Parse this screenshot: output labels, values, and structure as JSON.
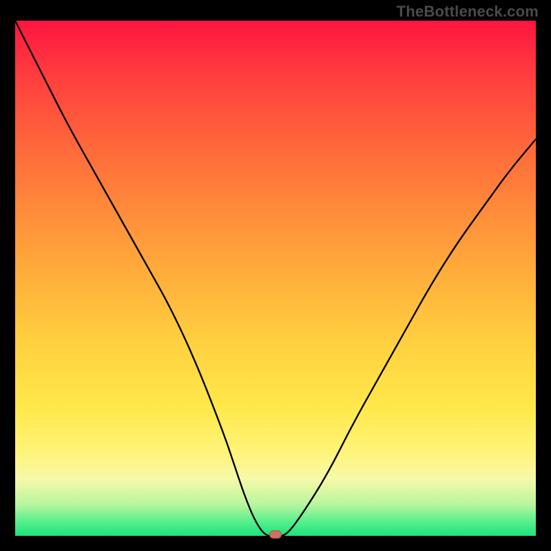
{
  "watermark": "TheBottleneck.com",
  "colors": {
    "frame": "#000000",
    "curve_stroke": "#000000",
    "marker_fill": "#d17060",
    "gradient_top": "#ff1540",
    "gradient_bottom": "#18e47a"
  },
  "chart_data": {
    "type": "line",
    "title": "",
    "xlabel": "",
    "ylabel": "",
    "xlim": [
      0,
      100
    ],
    "ylim": [
      0,
      100
    ],
    "x": [
      0,
      5,
      10,
      15,
      20,
      25,
      30,
      35,
      40,
      42,
      44,
      46,
      48,
      50,
      52,
      55,
      60,
      65,
      70,
      75,
      80,
      85,
      90,
      95,
      100
    ],
    "values": [
      100,
      90,
      80,
      71,
      62,
      53,
      44,
      33,
      20,
      14,
      8,
      3,
      0,
      0,
      0,
      4,
      12,
      22,
      31,
      40,
      49,
      57,
      64,
      71,
      77
    ],
    "valley_segment": {
      "x_start": 46,
      "x_end": 52,
      "y": 0
    },
    "marker": {
      "x": 50,
      "y": 0
    }
  }
}
